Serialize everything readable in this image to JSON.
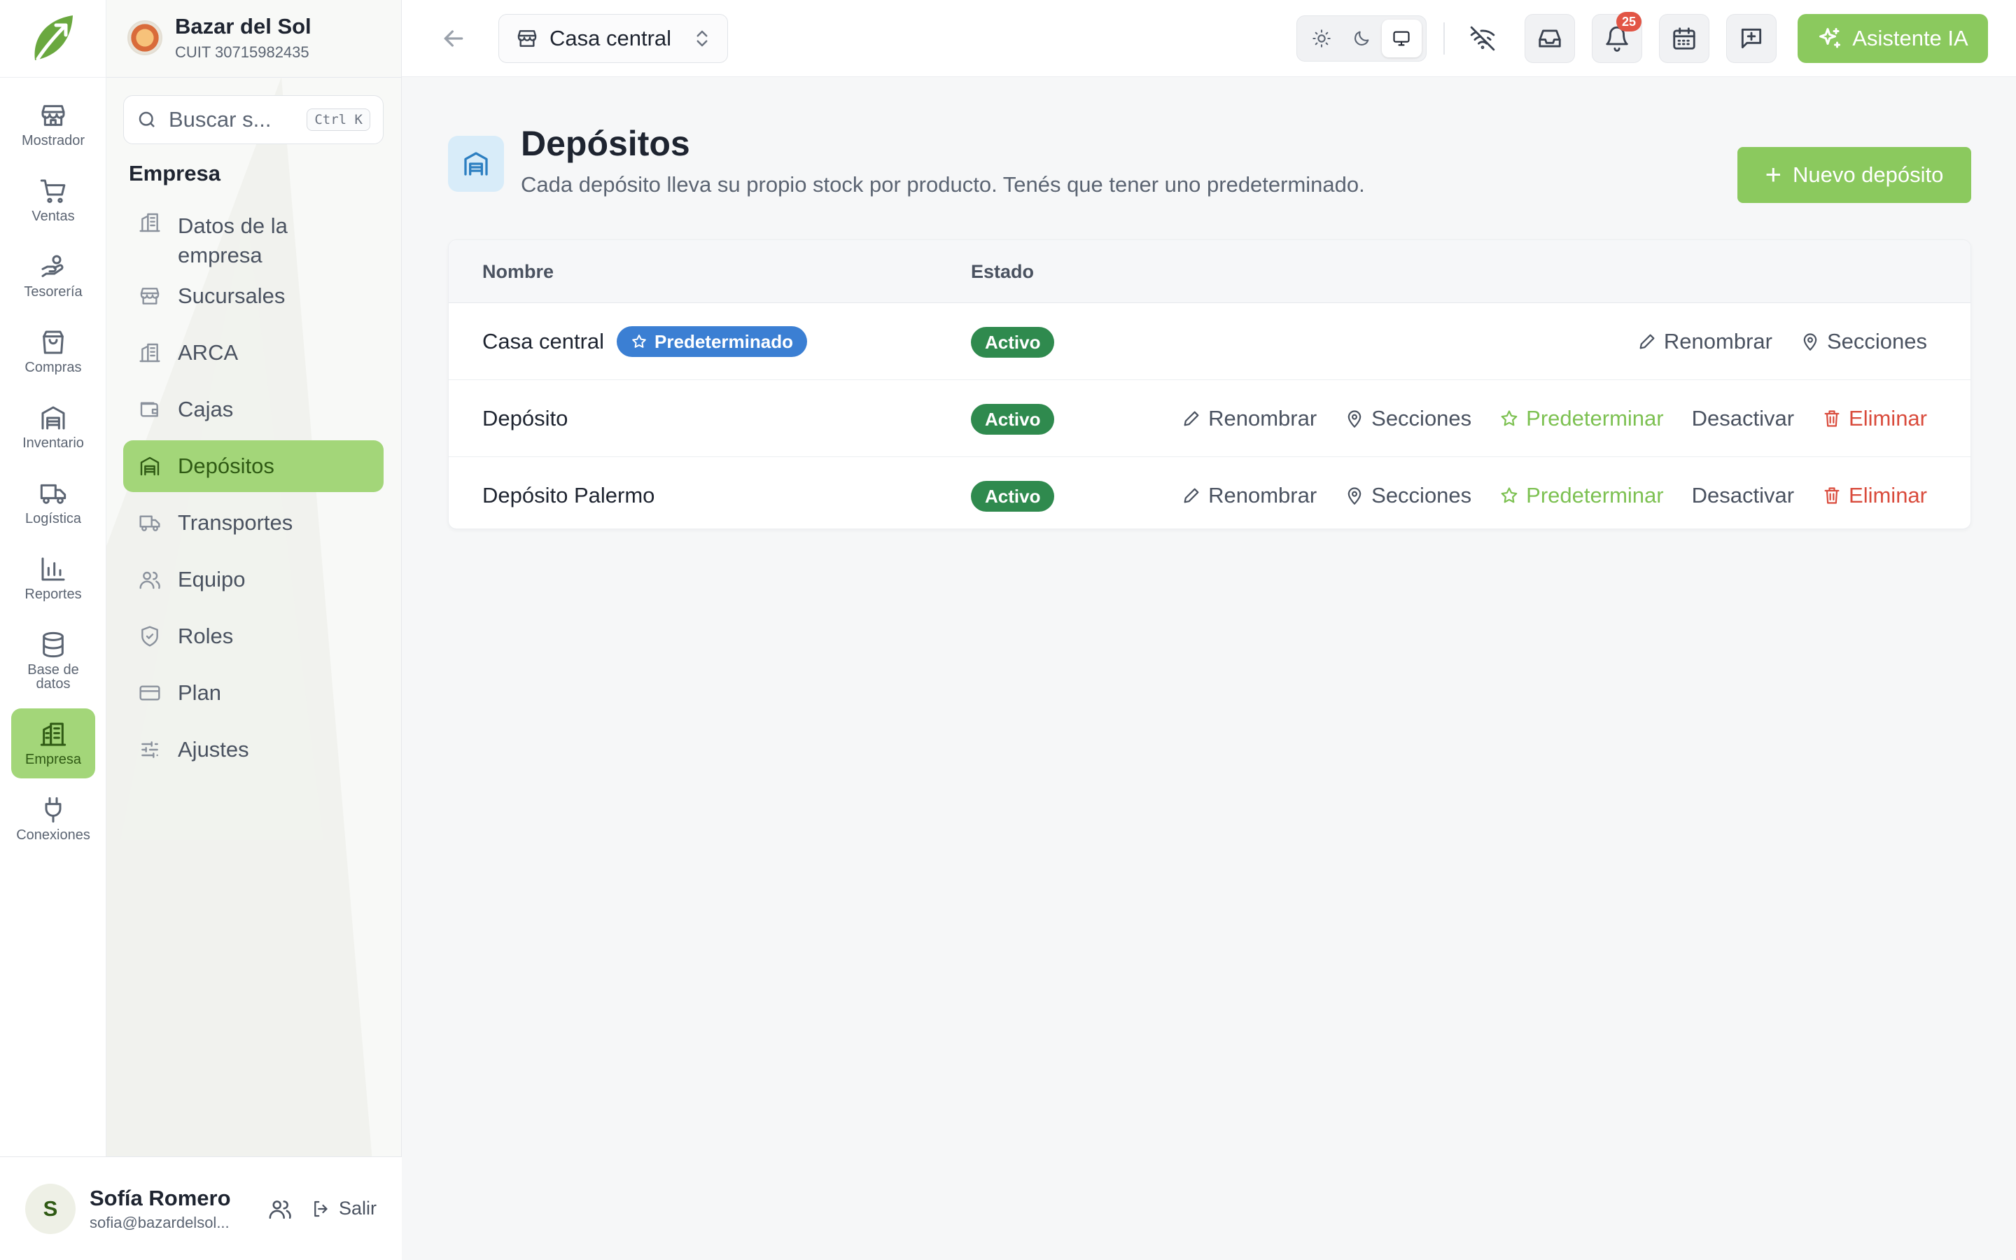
{
  "org": {
    "name": "Bazar del Sol",
    "cuit": "CUIT 30715982435"
  },
  "rail": {
    "items": [
      {
        "label": "Mostrador",
        "icon": "store-icon",
        "active": false
      },
      {
        "label": "Ventas",
        "icon": "cart-icon",
        "active": false
      },
      {
        "label": "Tesorería",
        "icon": "hand-coins-icon",
        "active": false
      },
      {
        "label": "Compras",
        "icon": "shopping-bag-icon",
        "active": false
      },
      {
        "label": "Inventario",
        "icon": "warehouse-icon",
        "active": false
      },
      {
        "label": "Logística",
        "icon": "truck-icon",
        "active": false
      },
      {
        "label": "Reportes",
        "icon": "bar-chart-icon",
        "active": false
      },
      {
        "label": "Base de datos",
        "icon": "database-icon",
        "active": false
      },
      {
        "label": "Empresa",
        "icon": "building-icon",
        "active": true
      },
      {
        "label": "Conexiones",
        "icon": "plug-icon",
        "active": false
      }
    ]
  },
  "search": {
    "placeholder": "Buscar s...",
    "shortcut": "Ctrl K"
  },
  "side": {
    "section": "Empresa",
    "items": [
      {
        "label": "Datos de la empresa",
        "icon": "building-icon",
        "active": false
      },
      {
        "label": "Sucursales",
        "icon": "store-icon",
        "active": false
      },
      {
        "label": "ARCA",
        "icon": "building-icon",
        "active": false
      },
      {
        "label": "Cajas",
        "icon": "wallet-icon",
        "active": false
      },
      {
        "label": "Depósitos",
        "icon": "warehouse-icon",
        "active": true
      },
      {
        "label": "Transportes",
        "icon": "truck-icon",
        "active": false
      },
      {
        "label": "Equipo",
        "icon": "users-icon",
        "active": false
      },
      {
        "label": "Roles",
        "icon": "shield-icon",
        "active": false
      },
      {
        "label": "Plan",
        "icon": "credit-card-icon",
        "active": false
      },
      {
        "label": "Ajustes",
        "icon": "sliders-icon",
        "active": false
      }
    ]
  },
  "user": {
    "initial": "S",
    "name": "Sofía Romero",
    "email": "sofia@bazardelsol...",
    "logout": "Salir"
  },
  "topbar": {
    "branch": "Casa central",
    "notifications_count": "25",
    "ai_label": "Asistente IA",
    "theme_selected": "system"
  },
  "page": {
    "title": "Depósitos",
    "subtitle": "Cada depósito lleva su propio stock por producto. Tenés que tener uno predeterminado.",
    "new_button": "Nuevo depósito"
  },
  "table": {
    "headers": {
      "name": "Nombre",
      "status": "Estado"
    },
    "default_badge": "Predeterminado",
    "actions": {
      "rename": "Renombrar",
      "sections": "Secciones",
      "make_default": "Predeterminar",
      "deactivate": "Desactivar",
      "delete": "Eliminar"
    },
    "rows": [
      {
        "name": "Casa central",
        "status": "Activo",
        "is_default": true
      },
      {
        "name": "Depósito",
        "status": "Activo",
        "is_default": false
      },
      {
        "name": "Depósito Palermo",
        "status": "Activo",
        "is_default": false
      }
    ]
  },
  "colors": {
    "accent_green": "#8bc95e",
    "active_nav": "#a3d679",
    "status_green": "#2f8a4e",
    "default_blue": "#3b7fd3",
    "danger_red": "#d94b3c"
  }
}
